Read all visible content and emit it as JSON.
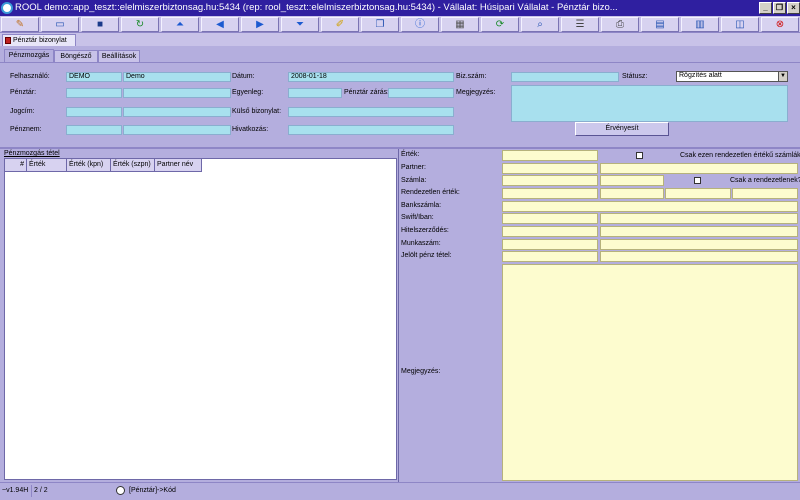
{
  "window": {
    "title": "ROOL demo::app_teszt::elelmiszerbiztonsag.hu:5434 (rep: rool_teszt::elelmiszerbiztonsag.hu:5434) - Vállalat: Húsipari Vállalat - Pénztár bizo...",
    "minimize": "_",
    "restore": "❐",
    "close": "×"
  },
  "toolbar": {
    "icons": [
      "edit-icon",
      "open-icon",
      "save-icon",
      "refresh-icon",
      "first-record-icon",
      "prev-record-icon",
      "next-record-icon",
      "last-record-icon",
      "note-icon",
      "copy-icon",
      "info-icon",
      "calendar-icon",
      "sync-icon",
      "search-icon",
      "list-icon",
      "print-icon",
      "grid-icon",
      "export-icon",
      "window-icon",
      "stop-icon"
    ]
  },
  "doc_tab": {
    "label": "Pénztár bizonylat"
  },
  "tabs": [
    "Pénzmozgás",
    "Böngésző",
    "Beállítások"
  ],
  "form": {
    "felhasznalo_label": "Felhasználó:",
    "felhasznalo_code": "DEMO",
    "felhasznalo_name": "Demo",
    "penztar_label": "Pénztár:",
    "penztar_code": "",
    "penztar_name": "",
    "jogcim_label": "Jogcím:",
    "jogcim_code": "",
    "jogcim_name": "",
    "penznem_label": "Pénznem:",
    "penznem_code": "",
    "penznem_name": "",
    "datum_label": "Dátum:",
    "datum_value": "2008-01-18",
    "egyenleg_label": "Egyenleg:",
    "egyenleg_value": "",
    "penztar_zaras_label": "Pénztár zárás:",
    "penztar_zaras_value": "",
    "kulso_bizonylat_label": "Külső bizonylat:",
    "kulso_bizonylat_value": "",
    "hivatkozas_label": "Hivatkozás:",
    "hivatkozas_value": "",
    "biz_szam_label": "Biz.szám:",
    "biz_szam_value": "",
    "statusz_label": "Státusz:",
    "statusz_value": "Rögzítés alatt",
    "megjegyzes_label": "Megjegyzés:",
    "megjegyzes_value": "",
    "ervenyesit_label": "Érvényesít"
  },
  "tetel": {
    "title": "Pénzmozgás tétel",
    "columns": [
      "#",
      "Érték",
      "Érték (kpn)",
      "Érték (szpn)",
      "Partner név"
    ]
  },
  "detail": {
    "ertek_label": "Érték:",
    "csak_ezen_label": "Csak ezen rendezetlen értékű számlák?",
    "partner_label": "Partner:",
    "szamla_label": "Számla:",
    "csak_a_label": "Csak a rendezetlenek?",
    "rendezetlen_label": "Rendezetlen érték:",
    "bankszamla_label": "Bankszámla:",
    "swift_label": "Swift/Iban:",
    "hitelszerzodes_label": "Hitelszerződés:",
    "munkaszam_label": "Munkaszám:",
    "jelolt_label": "Jelölt pénz tétel:",
    "megjegyzes_label": "Megjegyzés:"
  },
  "status": {
    "version": "~v1.94H",
    "record": "2 / 2",
    "path": "[Pénztár]->Kód"
  }
}
